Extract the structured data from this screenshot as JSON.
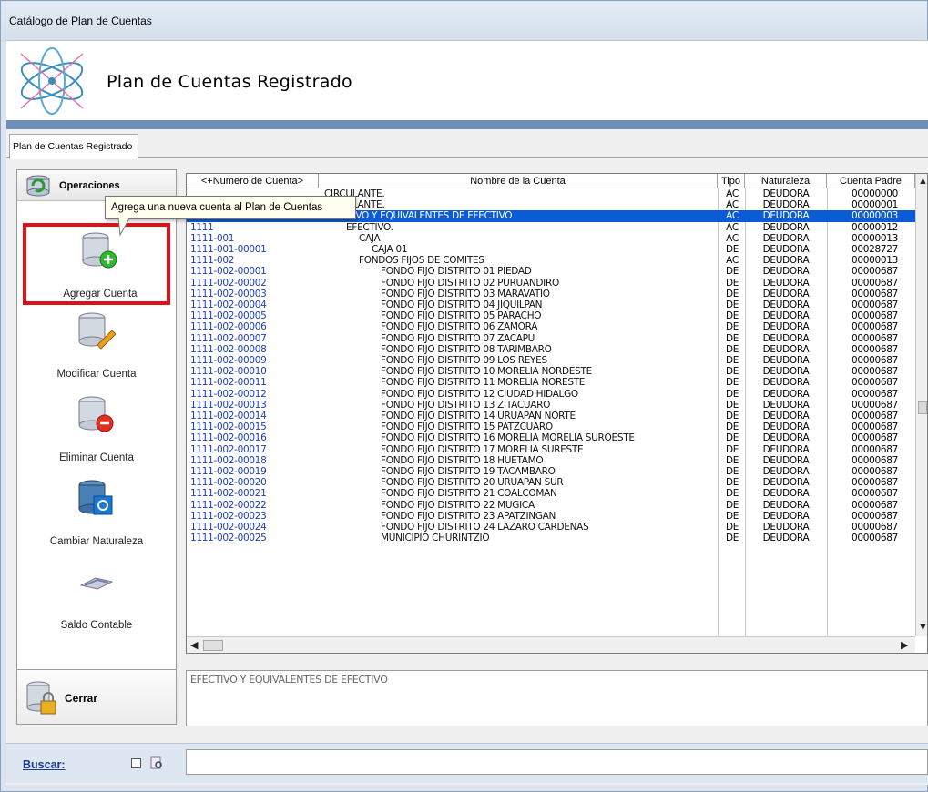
{
  "window": {
    "title": "Catálogo de Plan de Cuentas"
  },
  "header": {
    "heading": "Plan de Cuentas Registrado"
  },
  "tabs": [
    {
      "label": "Plan de Cuentas Registrado"
    }
  ],
  "operations": {
    "header_label": "Operaciones",
    "items": [
      {
        "label": "Agregar Cuenta",
        "icon": "database-add-icon"
      },
      {
        "label": "Modificar Cuenta",
        "icon": "database-edit-icon"
      },
      {
        "label": "Eliminar Cuenta",
        "icon": "database-remove-icon"
      },
      {
        "label": "Cambiar Naturaleza",
        "icon": "database-change-icon"
      },
      {
        "label": "Saldo Contable",
        "icon": "scale-icon"
      }
    ],
    "close_label": "Cerrar"
  },
  "tooltip": {
    "text": "Agrega una nueva cuenta al Plan de Cuentas"
  },
  "grid": {
    "columns": [
      "<+Numero de Cuenta>",
      "Nombre de la Cuenta",
      "Tipo",
      "Naturaleza",
      "Cuenta Padre"
    ],
    "rows": [
      {
        "num": "",
        "name": "CIRCULANTE.",
        "tipo": "AC",
        "nat": "DEUDORA",
        "padre": "00000000"
      },
      {
        "num": "",
        "name": "CIRCULANTE.",
        "tipo": "AC",
        "nat": "DEUDORA",
        "padre": "00000001"
      },
      {
        "num": "",
        "name": "EFECTIVO Y EQUIVALENTES DE EFECTIVO",
        "tipo": "AC",
        "nat": "DEUDORA",
        "padre": "00000003",
        "selected": true
      },
      {
        "num": "1111",
        "name": "EFECTIVO.",
        "tipo": "AC",
        "nat": "DEUDORA",
        "padre": "00000012"
      },
      {
        "num": "1111-001",
        "name": "CAJA",
        "tipo": "AC",
        "nat": "DEUDORA",
        "padre": "00000013"
      },
      {
        "num": "1111-001-00001",
        "name": "CAJA 01",
        "tipo": "DE",
        "nat": "DEUDORA",
        "padre": "00028727"
      },
      {
        "num": "1111-002",
        "name": "FONDOS FIJOS DE COMITES",
        "tipo": "AC",
        "nat": "DEUDORA",
        "padre": "00000013"
      },
      {
        "num": "1111-002-00001",
        "name": "FONDO FIJO DISTRITO 01 PIEDAD",
        "tipo": "DE",
        "nat": "DEUDORA",
        "padre": "00000687"
      },
      {
        "num": "1111-002-00002",
        "name": "FONDO FIJO DISTRITO 02 PURUANDIRO",
        "tipo": "DE",
        "nat": "DEUDORA",
        "padre": "00000687"
      },
      {
        "num": "1111-002-00003",
        "name": "FONDO FIJO DISTRITO 03 MARAVATIO",
        "tipo": "DE",
        "nat": "DEUDORA",
        "padre": "00000687"
      },
      {
        "num": "1111-002-00004",
        "name": "FONDO FIJO DISTRITO 04 JIQUILPAN",
        "tipo": "DE",
        "nat": "DEUDORA",
        "padre": "00000687"
      },
      {
        "num": "1111-002-00005",
        "name": "FONDO FIJO DISTRITO 05 PARACHO",
        "tipo": "DE",
        "nat": "DEUDORA",
        "padre": "00000687"
      },
      {
        "num": "1111-002-00006",
        "name": "FONDO FIJO DISTRITO 06 ZAMORA",
        "tipo": "DE",
        "nat": "DEUDORA",
        "padre": "00000687"
      },
      {
        "num": "1111-002-00007",
        "name": "FONDO FIJO DISTRITO 07 ZACAPU",
        "tipo": "DE",
        "nat": "DEUDORA",
        "padre": "00000687"
      },
      {
        "num": "1111-002-00008",
        "name": "FONDO FIJO DISTRITO 08 TARIMBARO",
        "tipo": "DE",
        "nat": "DEUDORA",
        "padre": "00000687"
      },
      {
        "num": "1111-002-00009",
        "name": "FONDO FIJO DISTRITO 09 LOS REYES",
        "tipo": "DE",
        "nat": "DEUDORA",
        "padre": "00000687"
      },
      {
        "num": "1111-002-00010",
        "name": "FONDO FIJO DISTRITO 10 MORELIA NORDESTE",
        "tipo": "DE",
        "nat": "DEUDORA",
        "padre": "00000687"
      },
      {
        "num": "1111-002-00011",
        "name": "FONDO FIJO DISTRITO 11 MORELIA NORESTE",
        "tipo": "DE",
        "nat": "DEUDORA",
        "padre": "00000687"
      },
      {
        "num": "1111-002-00012",
        "name": "FONDO FIJO DISTRITO 12 CIUDAD HIDALGO",
        "tipo": "DE",
        "nat": "DEUDORA",
        "padre": "00000687"
      },
      {
        "num": "1111-002-00013",
        "name": "FONDO FIJO DISTRITO 13 ZITACUARO",
        "tipo": "DE",
        "nat": "DEUDORA",
        "padre": "00000687"
      },
      {
        "num": "1111-002-00014",
        "name": "FONDO FIJO DISTRITO 14 URUAPAN NORTE",
        "tipo": "DE",
        "nat": "DEUDORA",
        "padre": "00000687"
      },
      {
        "num": "1111-002-00015",
        "name": "FONDO FIJO DISTRITO 15 PATZCUARO",
        "tipo": "DE",
        "nat": "DEUDORA",
        "padre": "00000687"
      },
      {
        "num": "1111-002-00016",
        "name": "FONDO FIJO DISTRITO 16 MORELIA MORELIA SUROESTE",
        "tipo": "DE",
        "nat": "DEUDORA",
        "padre": "00000687"
      },
      {
        "num": "1111-002-00017",
        "name": "FONDO FIJO DISTRITO 17 MORELIA SURESTE",
        "tipo": "DE",
        "nat": "DEUDORA",
        "padre": "00000687"
      },
      {
        "num": "1111-002-00018",
        "name": "FONDO FIJO DISTRITO 18 HUETAMO",
        "tipo": "DE",
        "nat": "DEUDORA",
        "padre": "00000687"
      },
      {
        "num": "1111-002-00019",
        "name": "FONDO FIJO DISTRITO 19 TACAMBARO",
        "tipo": "DE",
        "nat": "DEUDORA",
        "padre": "00000687"
      },
      {
        "num": "1111-002-00020",
        "name": "FONDO FIJO DISTRITO 20 URUAPAN SUR",
        "tipo": "DE",
        "nat": "DEUDORA",
        "padre": "00000687"
      },
      {
        "num": "1111-002-00021",
        "name": "FONDO FIJO DISTRITO 21 COALCOMAN",
        "tipo": "DE",
        "nat": "DEUDORA",
        "padre": "00000687"
      },
      {
        "num": "1111-002-00022",
        "name": "FONDO FIJO DISTRITO 22 MUGICA",
        "tipo": "DE",
        "nat": "DEUDORA",
        "padre": "00000687"
      },
      {
        "num": "1111-002-00023",
        "name": "FONDO FIJO DISTRITO 23 APATZINGAN",
        "tipo": "DE",
        "nat": "DEUDORA",
        "padre": "00000687"
      },
      {
        "num": "1111-002-00024",
        "name": "FONDO FIJO DISTRITO 24 LAZARO CARDENAS",
        "tipo": "DE",
        "nat": "DEUDORA",
        "padre": "00000687"
      },
      {
        "num": "1111-002-00025",
        "name": "MUNICIPIO CHURINTZIO",
        "tipo": "DE",
        "nat": "DEUDORA",
        "padre": "00000687"
      }
    ]
  },
  "description": {
    "text": "EFECTIVO Y EQUIVALENTES DE EFECTIVO"
  },
  "search": {
    "label": "Buscar:",
    "value": ""
  },
  "colors": {
    "selection": "#0b5ad8",
    "account_number": "#1c3fb5",
    "highlight_border": "#e0101a",
    "header_bar": "#6d8fb8"
  }
}
